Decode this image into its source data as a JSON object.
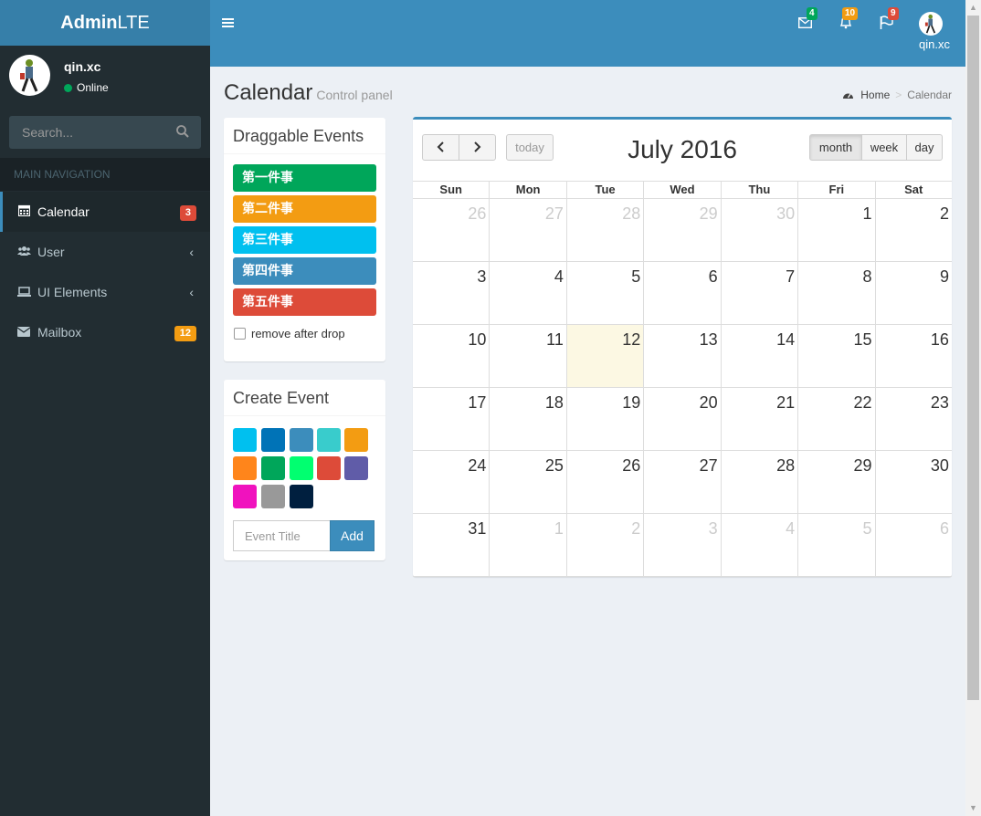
{
  "app": {
    "logo_bold": "Admin",
    "logo_light": "LTE"
  },
  "user": {
    "name": "qin.xc",
    "status": "Online"
  },
  "search": {
    "placeholder": "Search..."
  },
  "nav": {
    "header": "MAIN NAVIGATION",
    "items": [
      {
        "label": "Calendar",
        "icon": "calendar-icon",
        "badge": "3",
        "badge_color": "#dd4b39"
      },
      {
        "label": "User",
        "icon": "users-icon"
      },
      {
        "label": "UI Elements",
        "icon": "laptop-icon"
      },
      {
        "label": "Mailbox",
        "icon": "envelope-icon",
        "badge": "12",
        "badge_color": "#f39c12"
      }
    ]
  },
  "topbar": {
    "messages_count": "4",
    "messages_color": "#00a65a",
    "notifications_count": "10",
    "notifications_color": "#f39c12",
    "tasks_count": "9",
    "tasks_color": "#dd4b39",
    "username": "qin.xc"
  },
  "page": {
    "title": "Calendar",
    "subtitle": "Control panel"
  },
  "breadcrumb": {
    "home": "Home",
    "current": "Calendar"
  },
  "draggable": {
    "title": "Draggable Events",
    "events": [
      {
        "label": "第一件事",
        "color": "#00a65a"
      },
      {
        "label": "第二件事",
        "color": "#f39c12"
      },
      {
        "label": "第三件事",
        "color": "#00c0ef"
      },
      {
        "label": "第四件事",
        "color": "#3c8dbc"
      },
      {
        "label": "第五件事",
        "color": "#dd4b39"
      }
    ],
    "remove_label": "remove after drop"
  },
  "create_event": {
    "title": "Create Event",
    "colors": [
      "#00c0ef",
      "#0073b7",
      "#3c8dbc",
      "#39cccc",
      "#f39c12",
      "#ff851b",
      "#00a65a",
      "#01ff70",
      "#dd4b39",
      "#605ca8",
      "#f012be",
      "#999999",
      "#001f3f"
    ],
    "input_placeholder": "Event Title",
    "add_label": "Add"
  },
  "calendar": {
    "title": "July 2016",
    "today_label": "today",
    "views": [
      "month",
      "week",
      "day"
    ],
    "active_view": "month",
    "weekdays": [
      "Sun",
      "Mon",
      "Tue",
      "Wed",
      "Thu",
      "Fri",
      "Sat"
    ],
    "weeks": [
      [
        "26",
        "27",
        "28",
        "29",
        "30",
        "1",
        "2"
      ],
      [
        "3",
        "4",
        "5",
        "6",
        "7",
        "8",
        "9"
      ],
      [
        "10",
        "11",
        "12",
        "13",
        "14",
        "15",
        "16"
      ],
      [
        "17",
        "18",
        "19",
        "20",
        "21",
        "22",
        "23"
      ],
      [
        "24",
        "25",
        "26",
        "27",
        "28",
        "29",
        "30"
      ],
      [
        "31",
        "1",
        "2",
        "3",
        "4",
        "5",
        "6"
      ]
    ],
    "other_month": [
      [
        true,
        true,
        true,
        true,
        true,
        false,
        false
      ],
      [
        false,
        false,
        false,
        false,
        false,
        false,
        false
      ],
      [
        false,
        false,
        false,
        false,
        false,
        false,
        false
      ],
      [
        false,
        false,
        false,
        false,
        false,
        false,
        false
      ],
      [
        false,
        false,
        false,
        false,
        false,
        false,
        false
      ],
      [
        false,
        true,
        true,
        true,
        true,
        true,
        true
      ]
    ],
    "today": "12"
  }
}
